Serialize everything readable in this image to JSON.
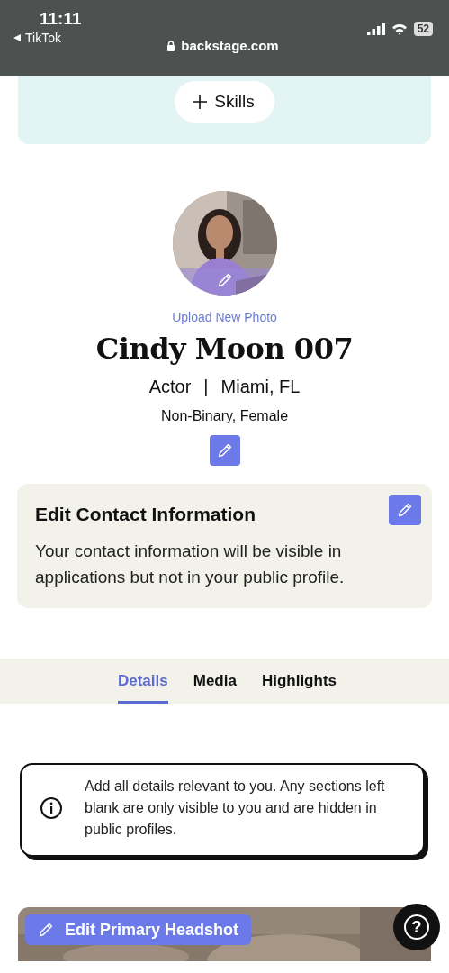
{
  "status_bar": {
    "time": "11:11",
    "back_app": "TikTok",
    "battery": "52"
  },
  "address_bar": {
    "url": "backstage.com"
  },
  "skills_button": {
    "label": "Skills"
  },
  "profile": {
    "upload_label": "Upload New Photo",
    "name": "Cindy Moon 007",
    "role": "Actor",
    "separator": "|",
    "location": "Miami, FL",
    "identity": "Non-Binary, Female"
  },
  "contact_card": {
    "title": "Edit Contact Information",
    "description": "Your contact information will be visible in applications but not in your public profile."
  },
  "tabs": [
    {
      "label": "Details",
      "selected": true
    },
    {
      "label": "Media",
      "selected": false
    },
    {
      "label": "Highlights",
      "selected": false
    }
  ],
  "notice": {
    "text": "Add all details relevant to you. Any sections left blank are only visible to you and are hidden in public profiles."
  },
  "headshot": {
    "button": "Edit Primary Headshot"
  },
  "help_button": {
    "label": "?"
  }
}
